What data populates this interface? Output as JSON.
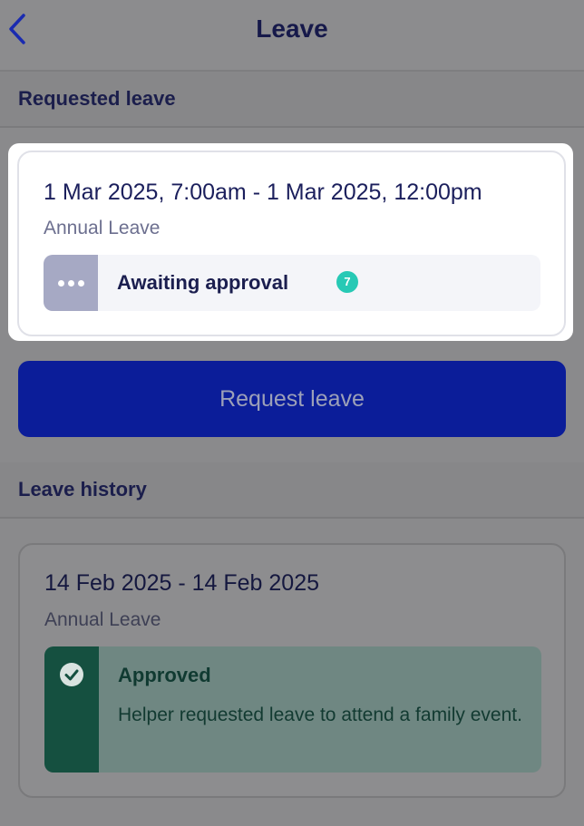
{
  "header": {
    "title": "Leave"
  },
  "requested_section": {
    "label": "Requested leave"
  },
  "pending_leave": {
    "date_range": "1 Mar 2025, 7:00am - 1 Mar 2025, 12:00pm",
    "leave_type": "Annual Leave",
    "status": "Awaiting approval",
    "badge_count": "7"
  },
  "request_button": {
    "label": "Request leave"
  },
  "history_section": {
    "label": "Leave history"
  },
  "history": [
    {
      "date_range": "14 Feb 2025 - 14 Feb 2025",
      "leave_type": "Annual Leave",
      "status": "Approved",
      "note": "Helper requested leave to attend a family event."
    }
  ],
  "colors": {
    "primary": "#0b1d99",
    "pending_badge": "#27c9b5",
    "approved": "#155040"
  },
  "icons": [
    "chevron-left-icon",
    "more-dots-icon",
    "check-circle-icon"
  ]
}
